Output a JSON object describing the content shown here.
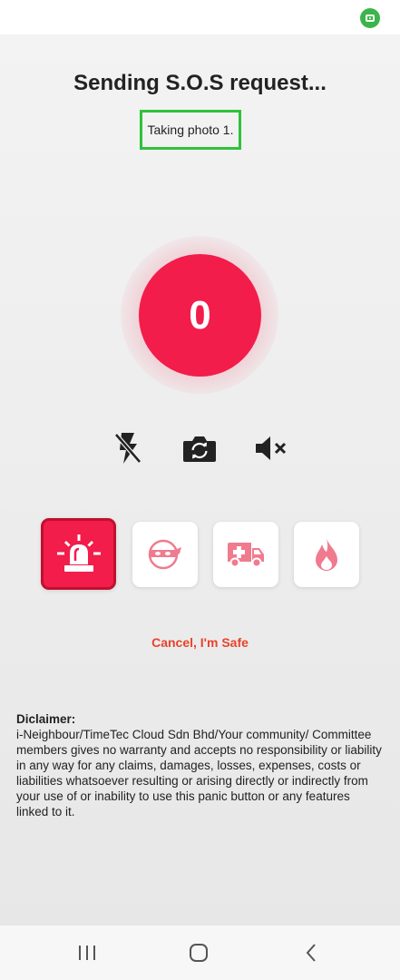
{
  "status_bar": {
    "icons": [
      "screen-record-icon"
    ]
  },
  "header": {
    "title": "Sending S.O.S request..."
  },
  "status": {
    "text": "Taking photo 1."
  },
  "counter": {
    "value": "0"
  },
  "controls": [
    {
      "icon": "flash-off-icon"
    },
    {
      "icon": "switch-camera-icon"
    },
    {
      "icon": "mute-icon"
    }
  ],
  "emergency_types": [
    {
      "icon": "siren-icon",
      "selected": true
    },
    {
      "icon": "robber-icon",
      "selected": false
    },
    {
      "icon": "ambulance-icon",
      "selected": false
    },
    {
      "icon": "fire-icon",
      "selected": false
    }
  ],
  "cancel": {
    "label": "Cancel, I'm Safe"
  },
  "disclaimer": {
    "title": "Diclaimer:",
    "body": "i-Neighbour/TimeTec Cloud Sdn Bhd/Your community/ Committee members gives no warranty and accepts no responsibility or liability in any way for any claims, damages, losses, expenses, costs or liabilities whatsoever resulting or arising directly or indirectly from your use of or inability to use this panic button or any features linked to it."
  },
  "nav": {
    "buttons": [
      "recents-icon",
      "home-icon",
      "back-icon"
    ]
  },
  "colors": {
    "accent": "#f21d4a",
    "cancel": "#e8432b",
    "highlight_box": "#2ec23a"
  }
}
